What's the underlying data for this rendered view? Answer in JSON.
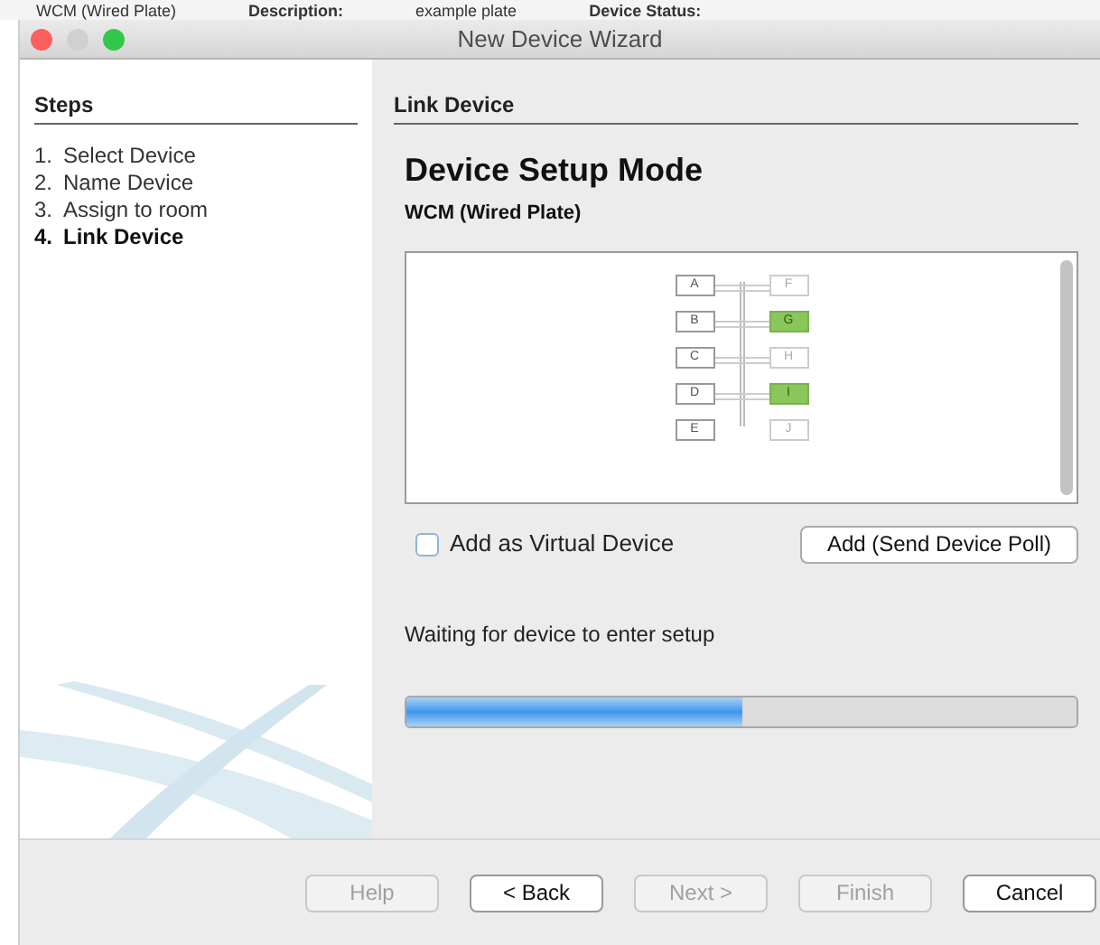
{
  "background": [
    "WCM (Wired Plate)",
    "Description:",
    "example plate",
    "Device Status:"
  ],
  "window": {
    "title": "New Device Wizard"
  },
  "steps": {
    "heading": "Steps",
    "items": [
      {
        "number": "1.",
        "label": "Select Device",
        "current": false
      },
      {
        "number": "2.",
        "label": "Name Device",
        "current": false
      },
      {
        "number": "3.",
        "label": "Assign to room",
        "current": false
      },
      {
        "number": "4.",
        "label": "Link Device",
        "current": true
      }
    ]
  },
  "content": {
    "heading": "Link Device",
    "title": "Device Setup Mode",
    "subtitle": "WCM (Wired Plate)",
    "diagram": {
      "left": [
        "A",
        "B",
        "C",
        "D",
        "E"
      ],
      "right": [
        {
          "label": "F",
          "lit": false
        },
        {
          "label": "G",
          "lit": true
        },
        {
          "label": "H",
          "lit": false
        },
        {
          "label": "I",
          "lit": true
        },
        {
          "label": "J",
          "lit": false
        }
      ]
    },
    "virtual": {
      "label": "Add as Virtual Device",
      "checked": false
    },
    "poll_button": "Add (Send Device Poll)",
    "status": "Waiting for device to enter setup",
    "progress": {
      "level": 0.5
    }
  },
  "buttons": [
    {
      "label": "Help",
      "disabled": true
    },
    {
      "label": "< Back",
      "disabled": false
    },
    {
      "label": "Next >",
      "disabled": true
    },
    {
      "label": "Finish",
      "disabled": true
    },
    {
      "label": "Cancel",
      "disabled": false
    }
  ]
}
